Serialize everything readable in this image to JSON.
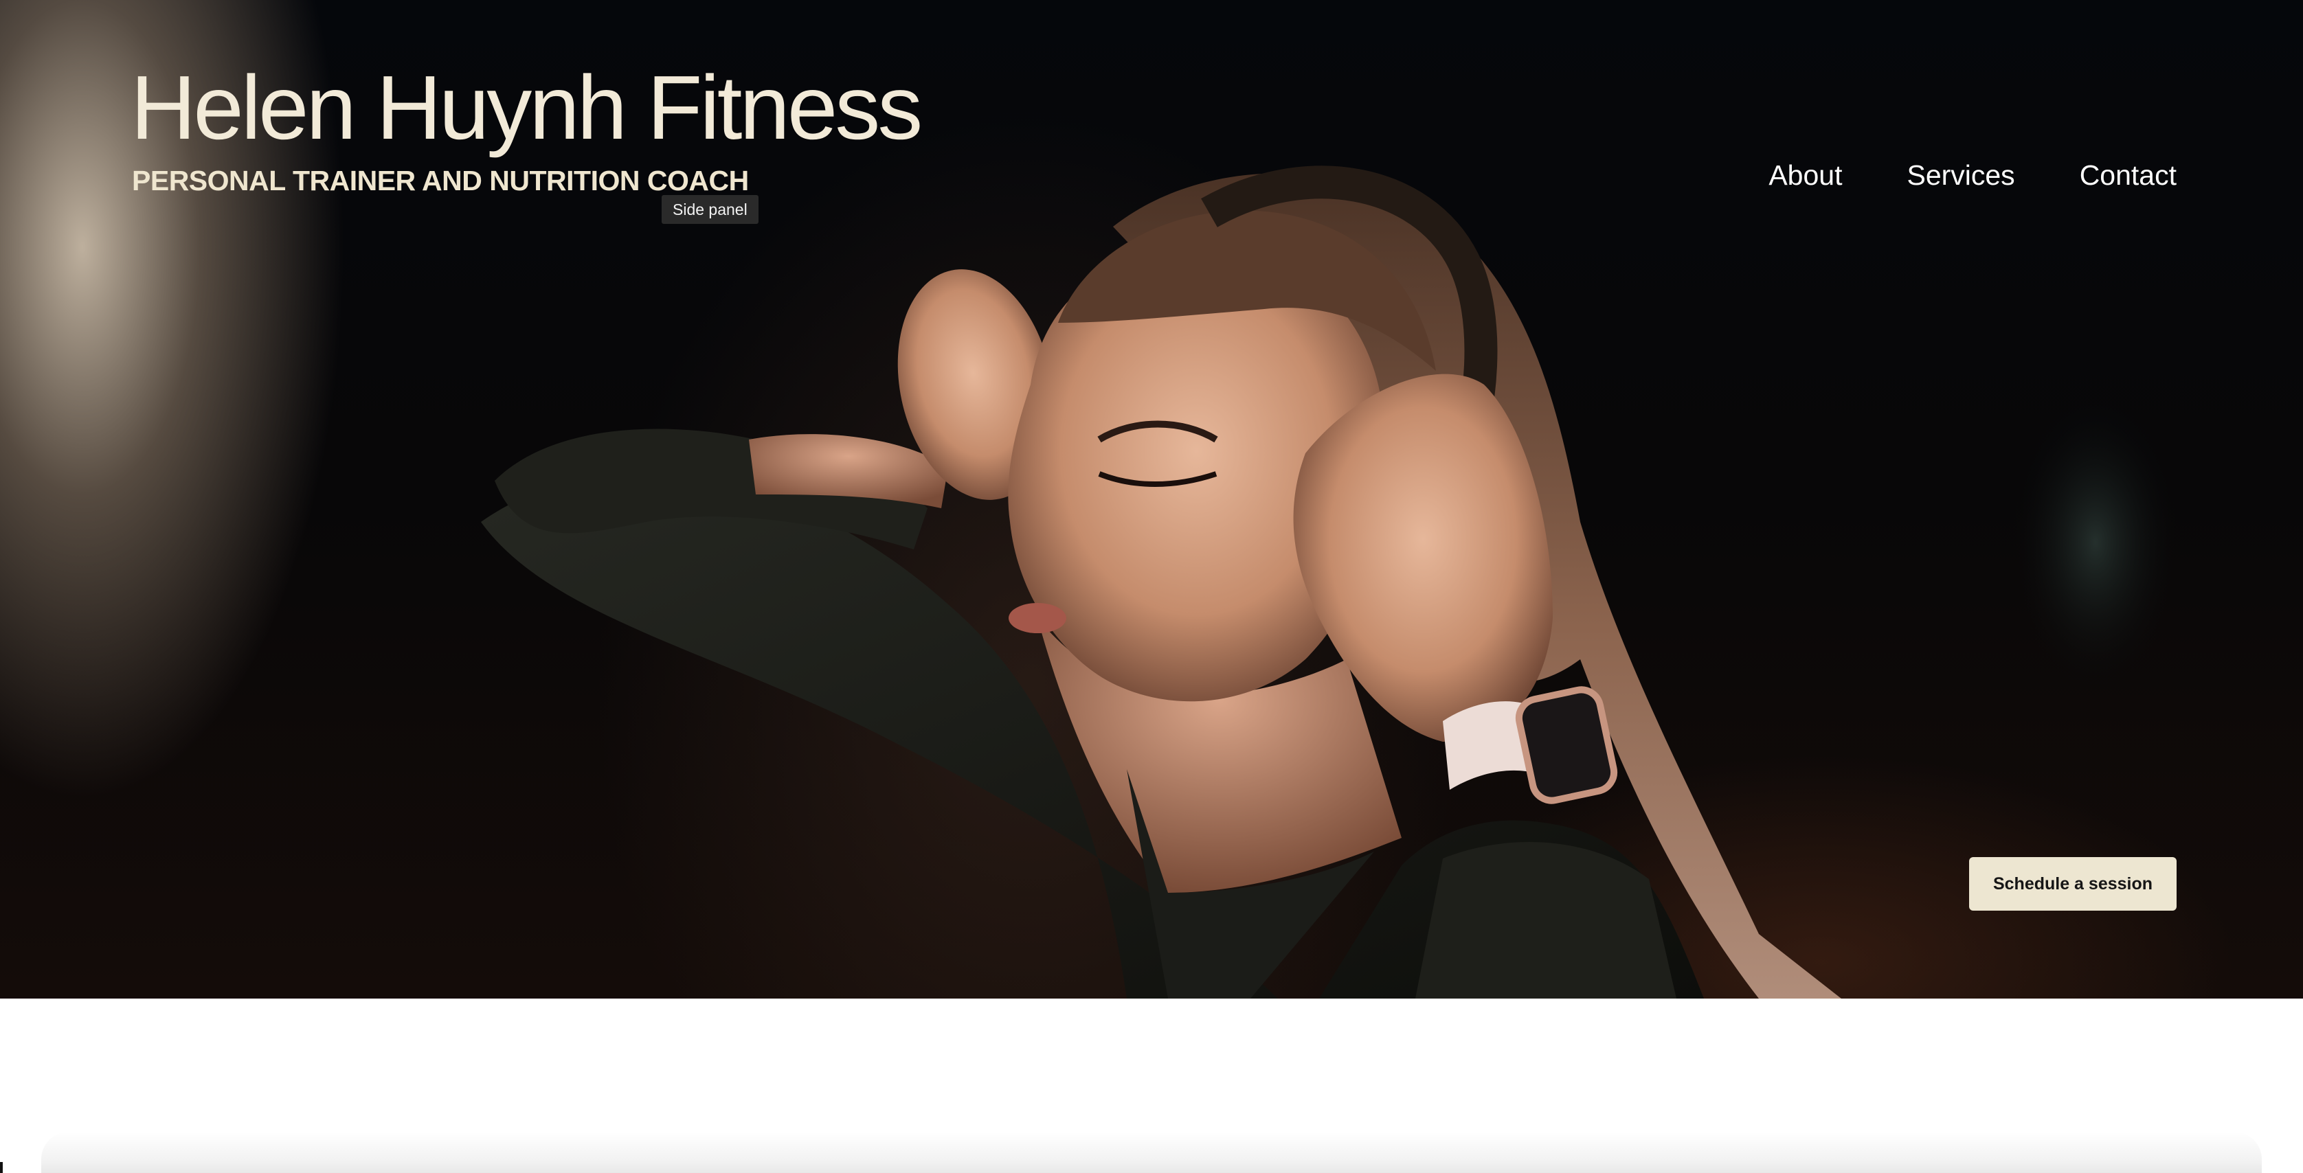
{
  "site": {
    "title": "Helen Huynh Fitness",
    "tagline": "PERSONAL TRAINER AND NUTRITION COACH"
  },
  "tooltip": {
    "text": "Side panel"
  },
  "nav": {
    "items": [
      {
        "label": "About"
      },
      {
        "label": "Services"
      },
      {
        "label": "Contact"
      }
    ]
  },
  "hero": {
    "cta_label": "Schedule a session",
    "image_subject": "woman-with-headphones-and-smartwatch"
  },
  "colors": {
    "hero_background": "#07080b",
    "text_cream": "#f2ead8",
    "button_background": "#ede6d1",
    "button_text": "#161616",
    "tooltip_background": "#2a2a2a",
    "page_background": "#ffffff"
  }
}
